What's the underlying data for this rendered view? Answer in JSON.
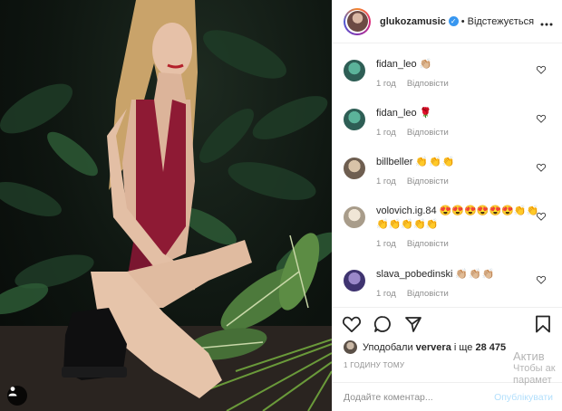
{
  "post": {
    "author": "glukozamusic",
    "separator": "•",
    "follow_state": "Відстежується",
    "more_icon": "ellipsis-icon"
  },
  "comments": [
    {
      "user": "fidan_leo",
      "text": "👏🏼",
      "time": "1 год",
      "reply": "Відповісти",
      "avatar_color": "#3e7a6a"
    },
    {
      "user": "fidan_leo",
      "text": "🌹",
      "time": "1 год",
      "reply": "Відповісти",
      "avatar_color": "#3e7a6a"
    },
    {
      "user": "billbeller",
      "text": "👏👏👏",
      "time": "1 год",
      "reply": "Відповісти",
      "avatar_color": "#9b8a78"
    },
    {
      "user": "volovich.ig.84",
      "text": "😍😍😍😍😍😍👏👏",
      "text2": "👏👏👏👏👏",
      "time": "1 год",
      "reply": "Відповісти",
      "avatar_color": "#c9c2b5"
    },
    {
      "user": "slava_pobedinski",
      "text": "👏🏼👏🏼👏🏼",
      "time": "1 год",
      "reply": "Відповісти",
      "avatar_color": "#6b5a9e"
    }
  ],
  "likes": {
    "prefix": "Уподобали",
    "user": "ververa",
    "middle": "і ще",
    "count": "28 475"
  },
  "timestamp": "1 ГОДИНУ ТОМУ",
  "comment_input": {
    "placeholder": "Додайте коментар...",
    "publish_label": "Опублікувати"
  },
  "watermark": {
    "line1": "Актив",
    "line2": "Чтобы ак",
    "line3": "парамет"
  },
  "colors": {
    "accent": "#3897f0",
    "muted": "#8e8e8e",
    "publish_disabled": "#b2dffc"
  }
}
